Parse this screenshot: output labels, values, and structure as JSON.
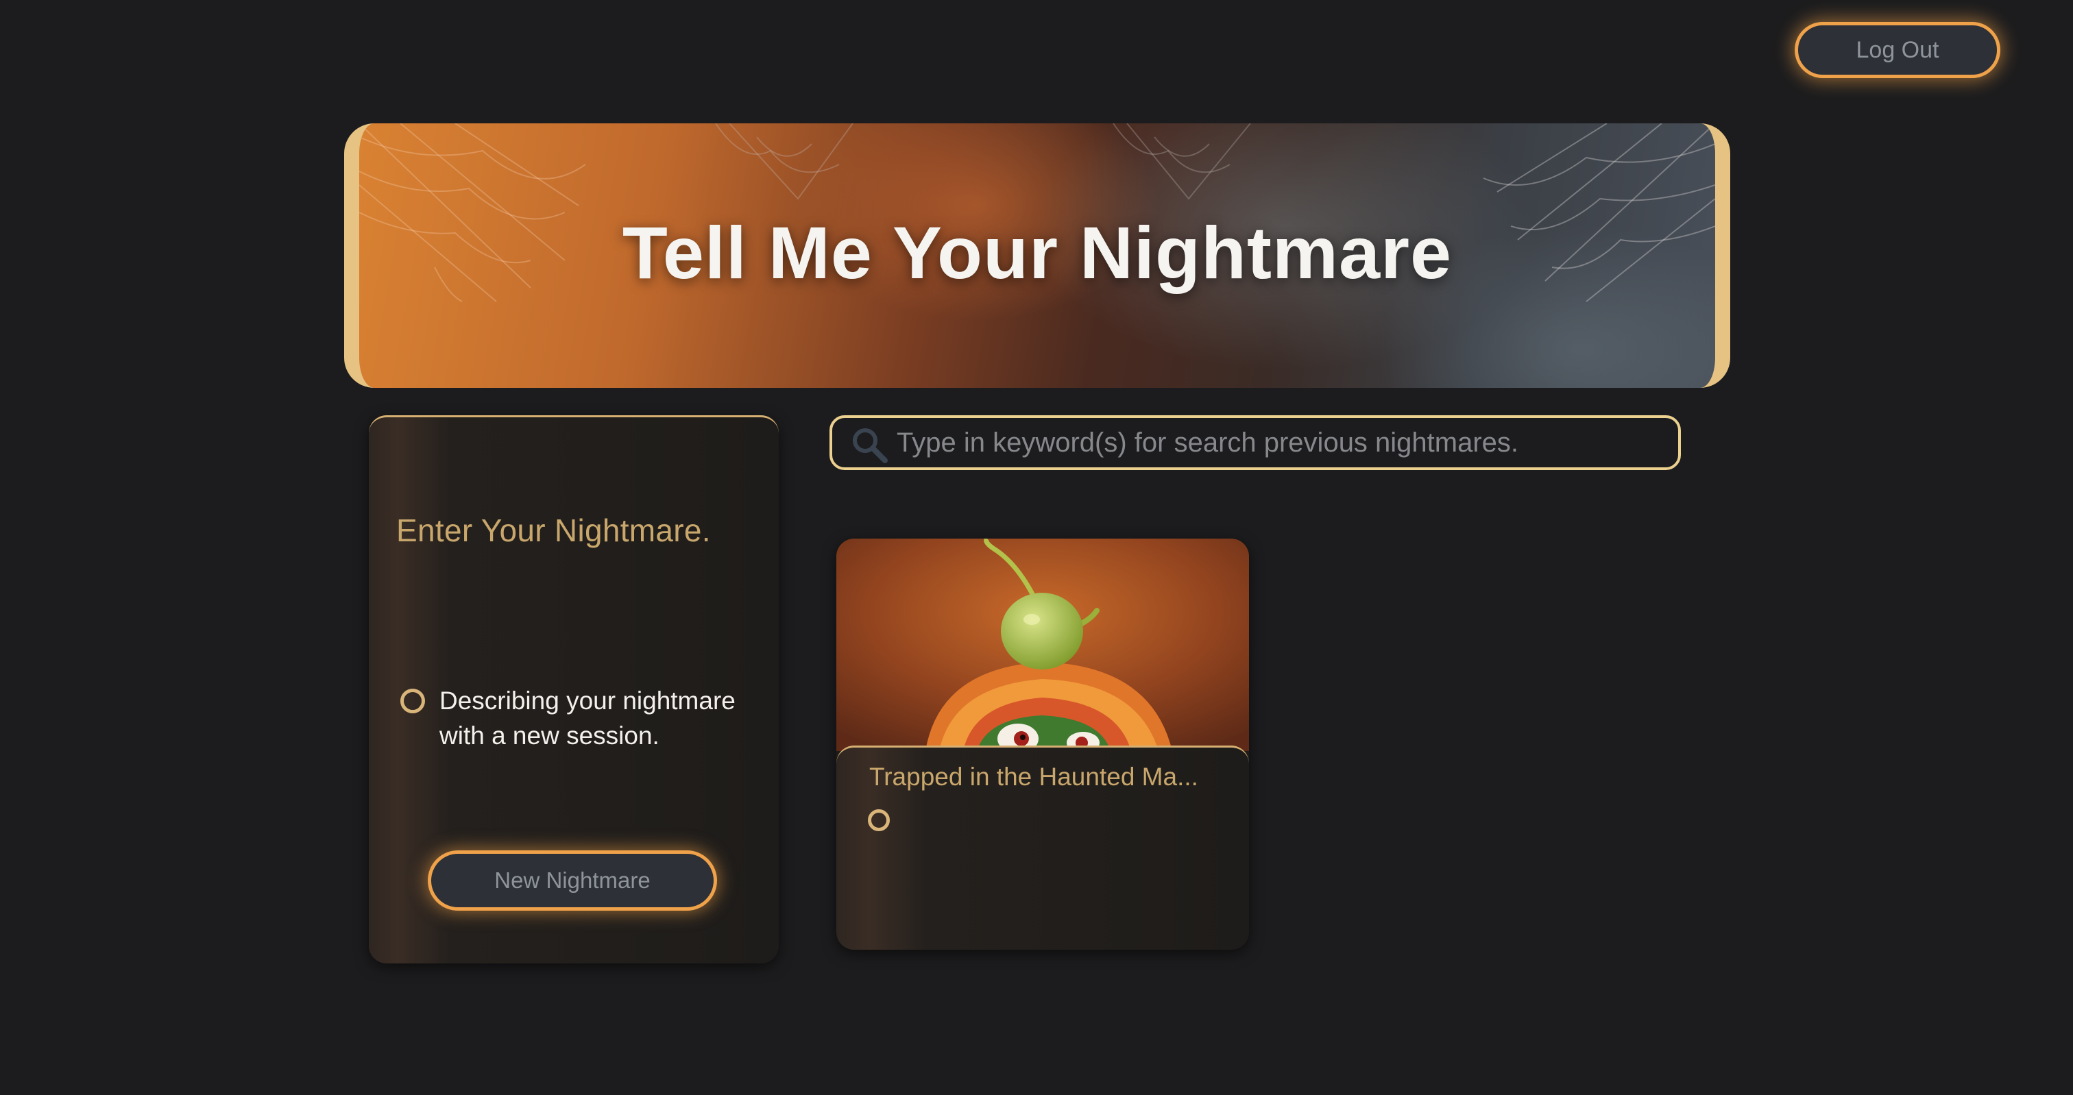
{
  "header": {
    "logout_label": "Log Out"
  },
  "banner": {
    "title": "Tell Me Your Nightmare"
  },
  "new_nightmare_panel": {
    "title": "Enter Your Nightmare.",
    "description": "Describing your nightmare with a new session.",
    "button_label": "New Nightmare"
  },
  "search": {
    "placeholder": "Type in keyword(s) for search previous nightmares.",
    "value": ""
  },
  "nightmares": [
    {
      "title": "Trapped in the Haunted Ma..."
    }
  ],
  "icons": {
    "search": "search-icon",
    "radio": "radio-ring-icon"
  },
  "colors": {
    "background": "#1c1c1e",
    "accent_orange": "#f0a24a",
    "accent_gold": "#e6c283",
    "text_gold": "#c9a76c",
    "button_fill": "#2d3036",
    "button_text": "#8f949c"
  }
}
